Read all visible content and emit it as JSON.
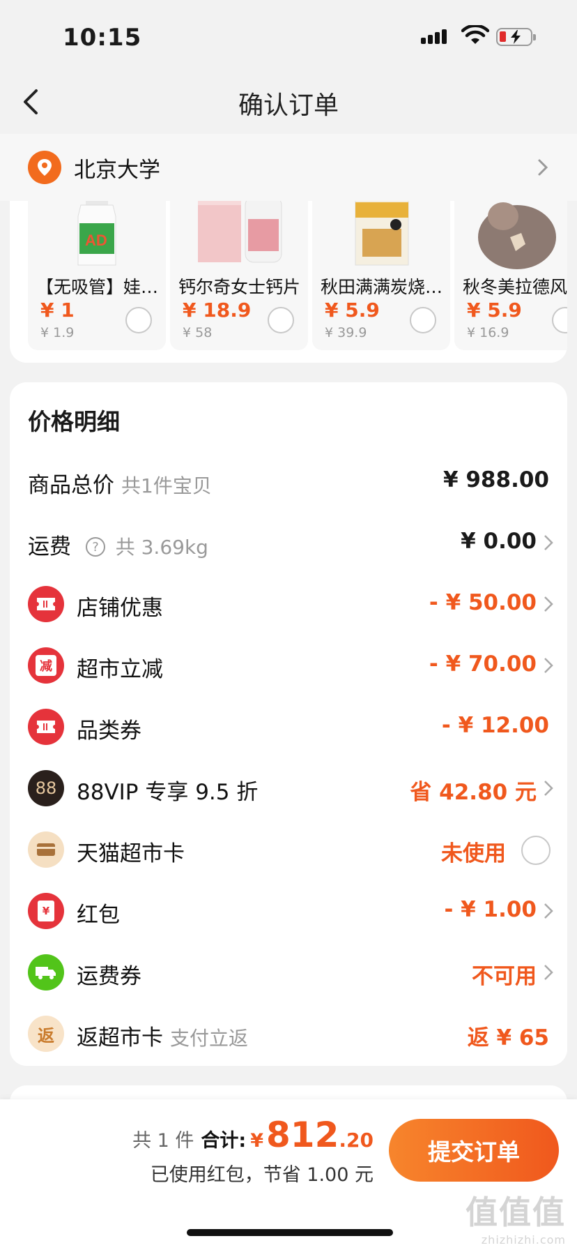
{
  "status_bar": {
    "time": "10:15"
  },
  "nav": {
    "title": "确认订单"
  },
  "address": {
    "name": "北京大学"
  },
  "products": [
    {
      "name": "【无吸管】娃哈哈AD钙奶",
      "price": "¥ 1",
      "original": "¥ 1.9"
    },
    {
      "name": "钙尔奇女士钙片",
      "price": "¥ 18.9",
      "original": "¥ 58"
    },
    {
      "name": "秋田满满炭烧饼干",
      "price": "¥ 5.9",
      "original": "¥ 39.9"
    },
    {
      "name": "秋冬美拉德风",
      "price": "¥ 5.9",
      "original": "¥ 16.9"
    }
  ],
  "price_detail": {
    "heading": "价格明细",
    "rows": [
      {
        "label": "商品总价",
        "sub": "共1件宝贝",
        "value": "¥ 988.00"
      },
      {
        "label": "运费",
        "sub": "共 3.69kg",
        "value": "¥ 0.00"
      },
      {
        "label": "店铺优惠",
        "value": "- ¥ 50.00",
        "icon": "coupon-icon"
      },
      {
        "label": "超市立减",
        "value": "- ¥ 70.00",
        "icon": "discount-icon",
        "icon_text": "减"
      },
      {
        "label": "品类券",
        "value": "- ¥ 12.00",
        "icon": "coupon-icon"
      },
      {
        "label": "88VIP 专享 9.5 折",
        "value": "省 42.80 元",
        "icon": "vip-icon",
        "icon_text": "88"
      },
      {
        "label": "天猫超市卡",
        "value": "未使用",
        "icon": "card-icon"
      },
      {
        "label": "红包",
        "value": "- ¥ 1.00",
        "icon": "red-packet-icon",
        "icon_text": "¥"
      },
      {
        "label": "运费券",
        "value": "不可用",
        "icon": "truck-icon"
      },
      {
        "label": "返超市卡",
        "sub": "支付立返",
        "value": "返 ¥ 65",
        "icon": "rebate-icon",
        "icon_text": "返"
      }
    ]
  },
  "footer": {
    "count": "共 1 件",
    "total_label": "合计:",
    "currency": "¥",
    "total_int": "812",
    "total_dec": ".20",
    "saved": "已使用红包，节省 1.00 元",
    "submit": "提交订单",
    "watermark": "值值值",
    "watermark_url": "zhizhizhi.com"
  },
  "colors": {
    "accent": "#f0581d",
    "red_icon": "#e5333b",
    "green_icon": "#52c41a"
  }
}
